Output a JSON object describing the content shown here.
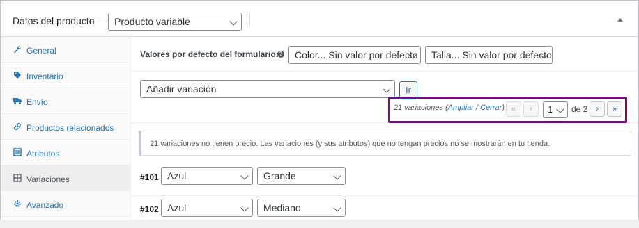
{
  "header": {
    "title": "Datos del producto —",
    "product_type": "Producto variable"
  },
  "sidebar": {
    "items": [
      {
        "label": "General",
        "icon": "wrench-icon"
      },
      {
        "label": "Inventario",
        "icon": "tag-icon"
      },
      {
        "label": "Envío",
        "icon": "truck-icon"
      },
      {
        "label": "Productos relacionados",
        "icon": "link-icon"
      },
      {
        "label": "Atributos",
        "icon": "list-icon"
      },
      {
        "label": "Variaciones",
        "icon": "grid-icon",
        "active": true
      },
      {
        "label": "Avanzado",
        "icon": "gear-icon"
      }
    ]
  },
  "defaults": {
    "label": "Valores por defecto del formulario:",
    "help": "?",
    "color_select": "Color... Sin valor por defecto",
    "size_select": "Talla... Sin valor por defecto"
  },
  "actions": {
    "variation_select": "Añadir variación",
    "go_button": "Ir"
  },
  "pagination": {
    "count_text": "21 variaciones",
    "expand": "Ampliar",
    "separator": "/",
    "close": "Cerrar",
    "first": "«",
    "prev": "‹",
    "page": "1",
    "of_label": "de 2",
    "next": "›",
    "last": "»",
    "highlight_color": "#7b0a80"
  },
  "notice": {
    "text": "21 variaciones no tienen precio. Las variaciones (y sus atributos) que no tengan precios no se mostrarán en tu tienda."
  },
  "variations": [
    {
      "id": "#101",
      "color": "Azul",
      "size": "Grande"
    },
    {
      "id": "#102",
      "color": "Azul",
      "size": "Mediano"
    }
  ]
}
